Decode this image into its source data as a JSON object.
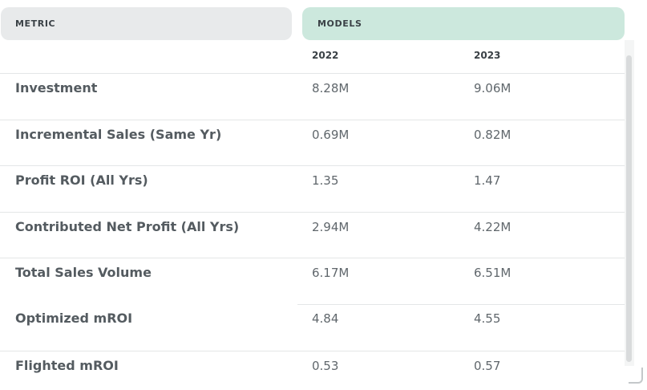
{
  "header": {
    "metric_label": "METRIC",
    "models_label": "MODELS"
  },
  "years": [
    "2022",
    "2023"
  ],
  "rows": [
    {
      "metric": "Investment",
      "values": [
        "8.28M",
        "9.06M"
      ]
    },
    {
      "metric": "Incremental Sales (Same Yr)",
      "values": [
        "0.69M",
        "0.82M"
      ]
    },
    {
      "metric": "Profit ROI (All Yrs)",
      "values": [
        "1.35",
        "1.47"
      ]
    },
    {
      "metric": "Contributed Net Profit (All Yrs)",
      "values": [
        "2.94M",
        "4.22M"
      ]
    },
    {
      "metric": "Total Sales Volume",
      "values": [
        "6.17M",
        "6.51M"
      ]
    },
    {
      "metric": "Optimized mROI",
      "values": [
        "4.84",
        "4.55"
      ]
    },
    {
      "metric": "Flighted mROI",
      "values": [
        "0.53",
        "0.57"
      ]
    }
  ],
  "colors": {
    "metric_header_bg": "#e8eaeb",
    "models_header_bg": "#cce8dd",
    "text": "#545b60"
  }
}
